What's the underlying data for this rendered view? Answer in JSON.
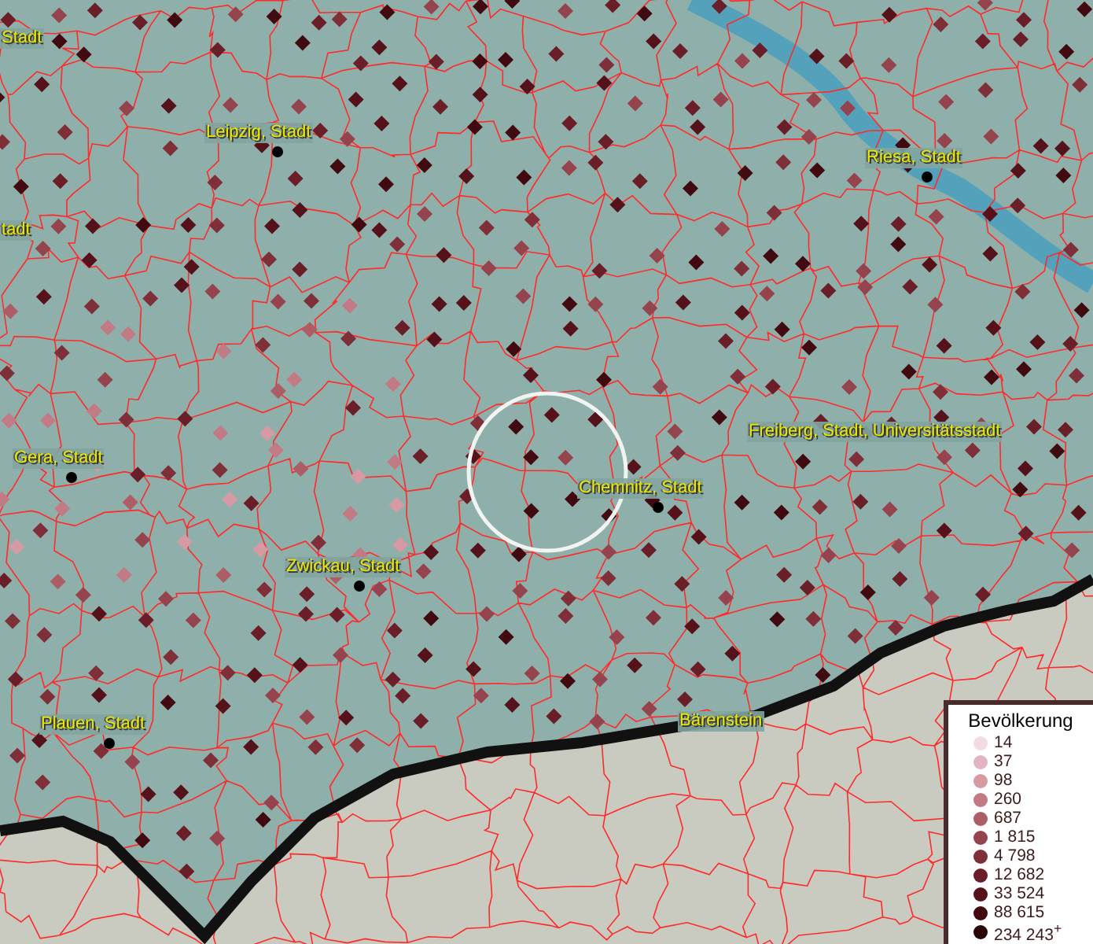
{
  "map": {
    "places": [
      {
        "name": "Stadt",
        "kind": "label"
      },
      {
        "name": "Leipzig, Stadt",
        "kind": "city"
      },
      {
        "name": "Riesa, Stadt",
        "kind": "city"
      },
      {
        "name": "tadt",
        "kind": "label"
      },
      {
        "name": "Gera, Stadt",
        "kind": "city"
      },
      {
        "name": "Freiberg, Stadt, Universitätsstadt",
        "kind": "city"
      },
      {
        "name": "Chemnitz, Stadt",
        "kind": "city"
      },
      {
        "name": "Zwickau, Stadt",
        "kind": "city"
      },
      {
        "name": "Plauen, Stadt",
        "kind": "city"
      },
      {
        "name": "Bärenstein",
        "kind": "label"
      }
    ]
  },
  "legend": {
    "title": "Bevölkerung",
    "items": [
      {
        "label": "14",
        "color": "#f3dbe6"
      },
      {
        "label": "37",
        "color": "#e2b5c2"
      },
      {
        "label": "98",
        "color": "#d79aa5"
      },
      {
        "label": "260",
        "color": "#c27a84"
      },
      {
        "label": "687",
        "color": "#ad5d66"
      },
      {
        "label": "1 815",
        "color": "#95444d"
      },
      {
        "label": "4 798",
        "color": "#7e2f38"
      },
      {
        "label": "12 682",
        "color": "#6a1e27"
      },
      {
        "label": "33 524",
        "color": "#55121a"
      },
      {
        "label": "88 615",
        "color": "#410a10"
      },
      {
        "label": "234 243$^{+}$",
        "color": "#2a0508"
      }
    ]
  }
}
